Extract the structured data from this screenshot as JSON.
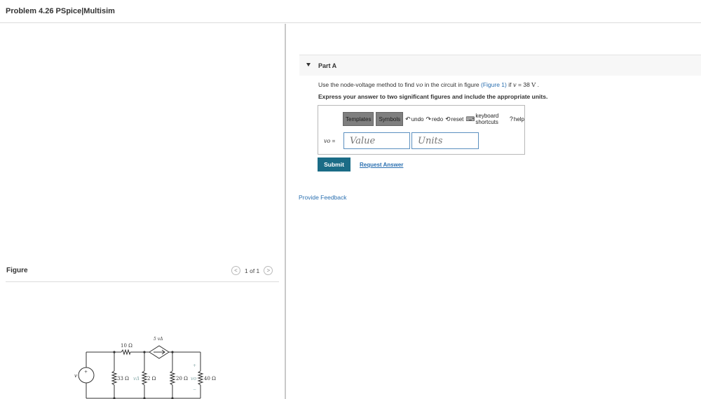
{
  "header": {
    "title": "Problem 4.26 PSpice|Multisim"
  },
  "figure_panel": {
    "label": "Figure",
    "pager": {
      "prev": "<",
      "text": "1 of 1",
      "next": ">"
    },
    "circuit": {
      "source_label": "v",
      "plus": "+",
      "minus": "−",
      "r1": "10 Ω",
      "r2": "33 Ω",
      "r3": "2 Ω",
      "r4": "20 Ω",
      "r5": "40 Ω",
      "dependent": "5 vΔ",
      "vdelta": "vΔ",
      "vo": "vo"
    }
  },
  "part": {
    "title": "Part A"
  },
  "question": {
    "prefix": "Use the node-voltage method to find ",
    "var": "vo",
    "mid": " in the circuit in figure ",
    "link": "(Figure 1)",
    "cond_pre": " if ",
    "cond_var": "v",
    "cond_val": " = 38 ",
    "unit": "V",
    "end": " ."
  },
  "instruction": "Express your answer to two significant figures and include the appropriate units.",
  "toolbar": {
    "templates": "Templates",
    "symbols": "Symbols",
    "undo": "undo",
    "redo": "redo",
    "reset": "reset",
    "keyboard": "keyboard shortcuts",
    "help": "help"
  },
  "answer": {
    "var_label": "vo",
    "equals": " =",
    "value_placeholder": "Value",
    "units_placeholder": "Units"
  },
  "actions": {
    "submit": "Submit",
    "request": "Request Answer"
  },
  "feedback": "Provide Feedback"
}
